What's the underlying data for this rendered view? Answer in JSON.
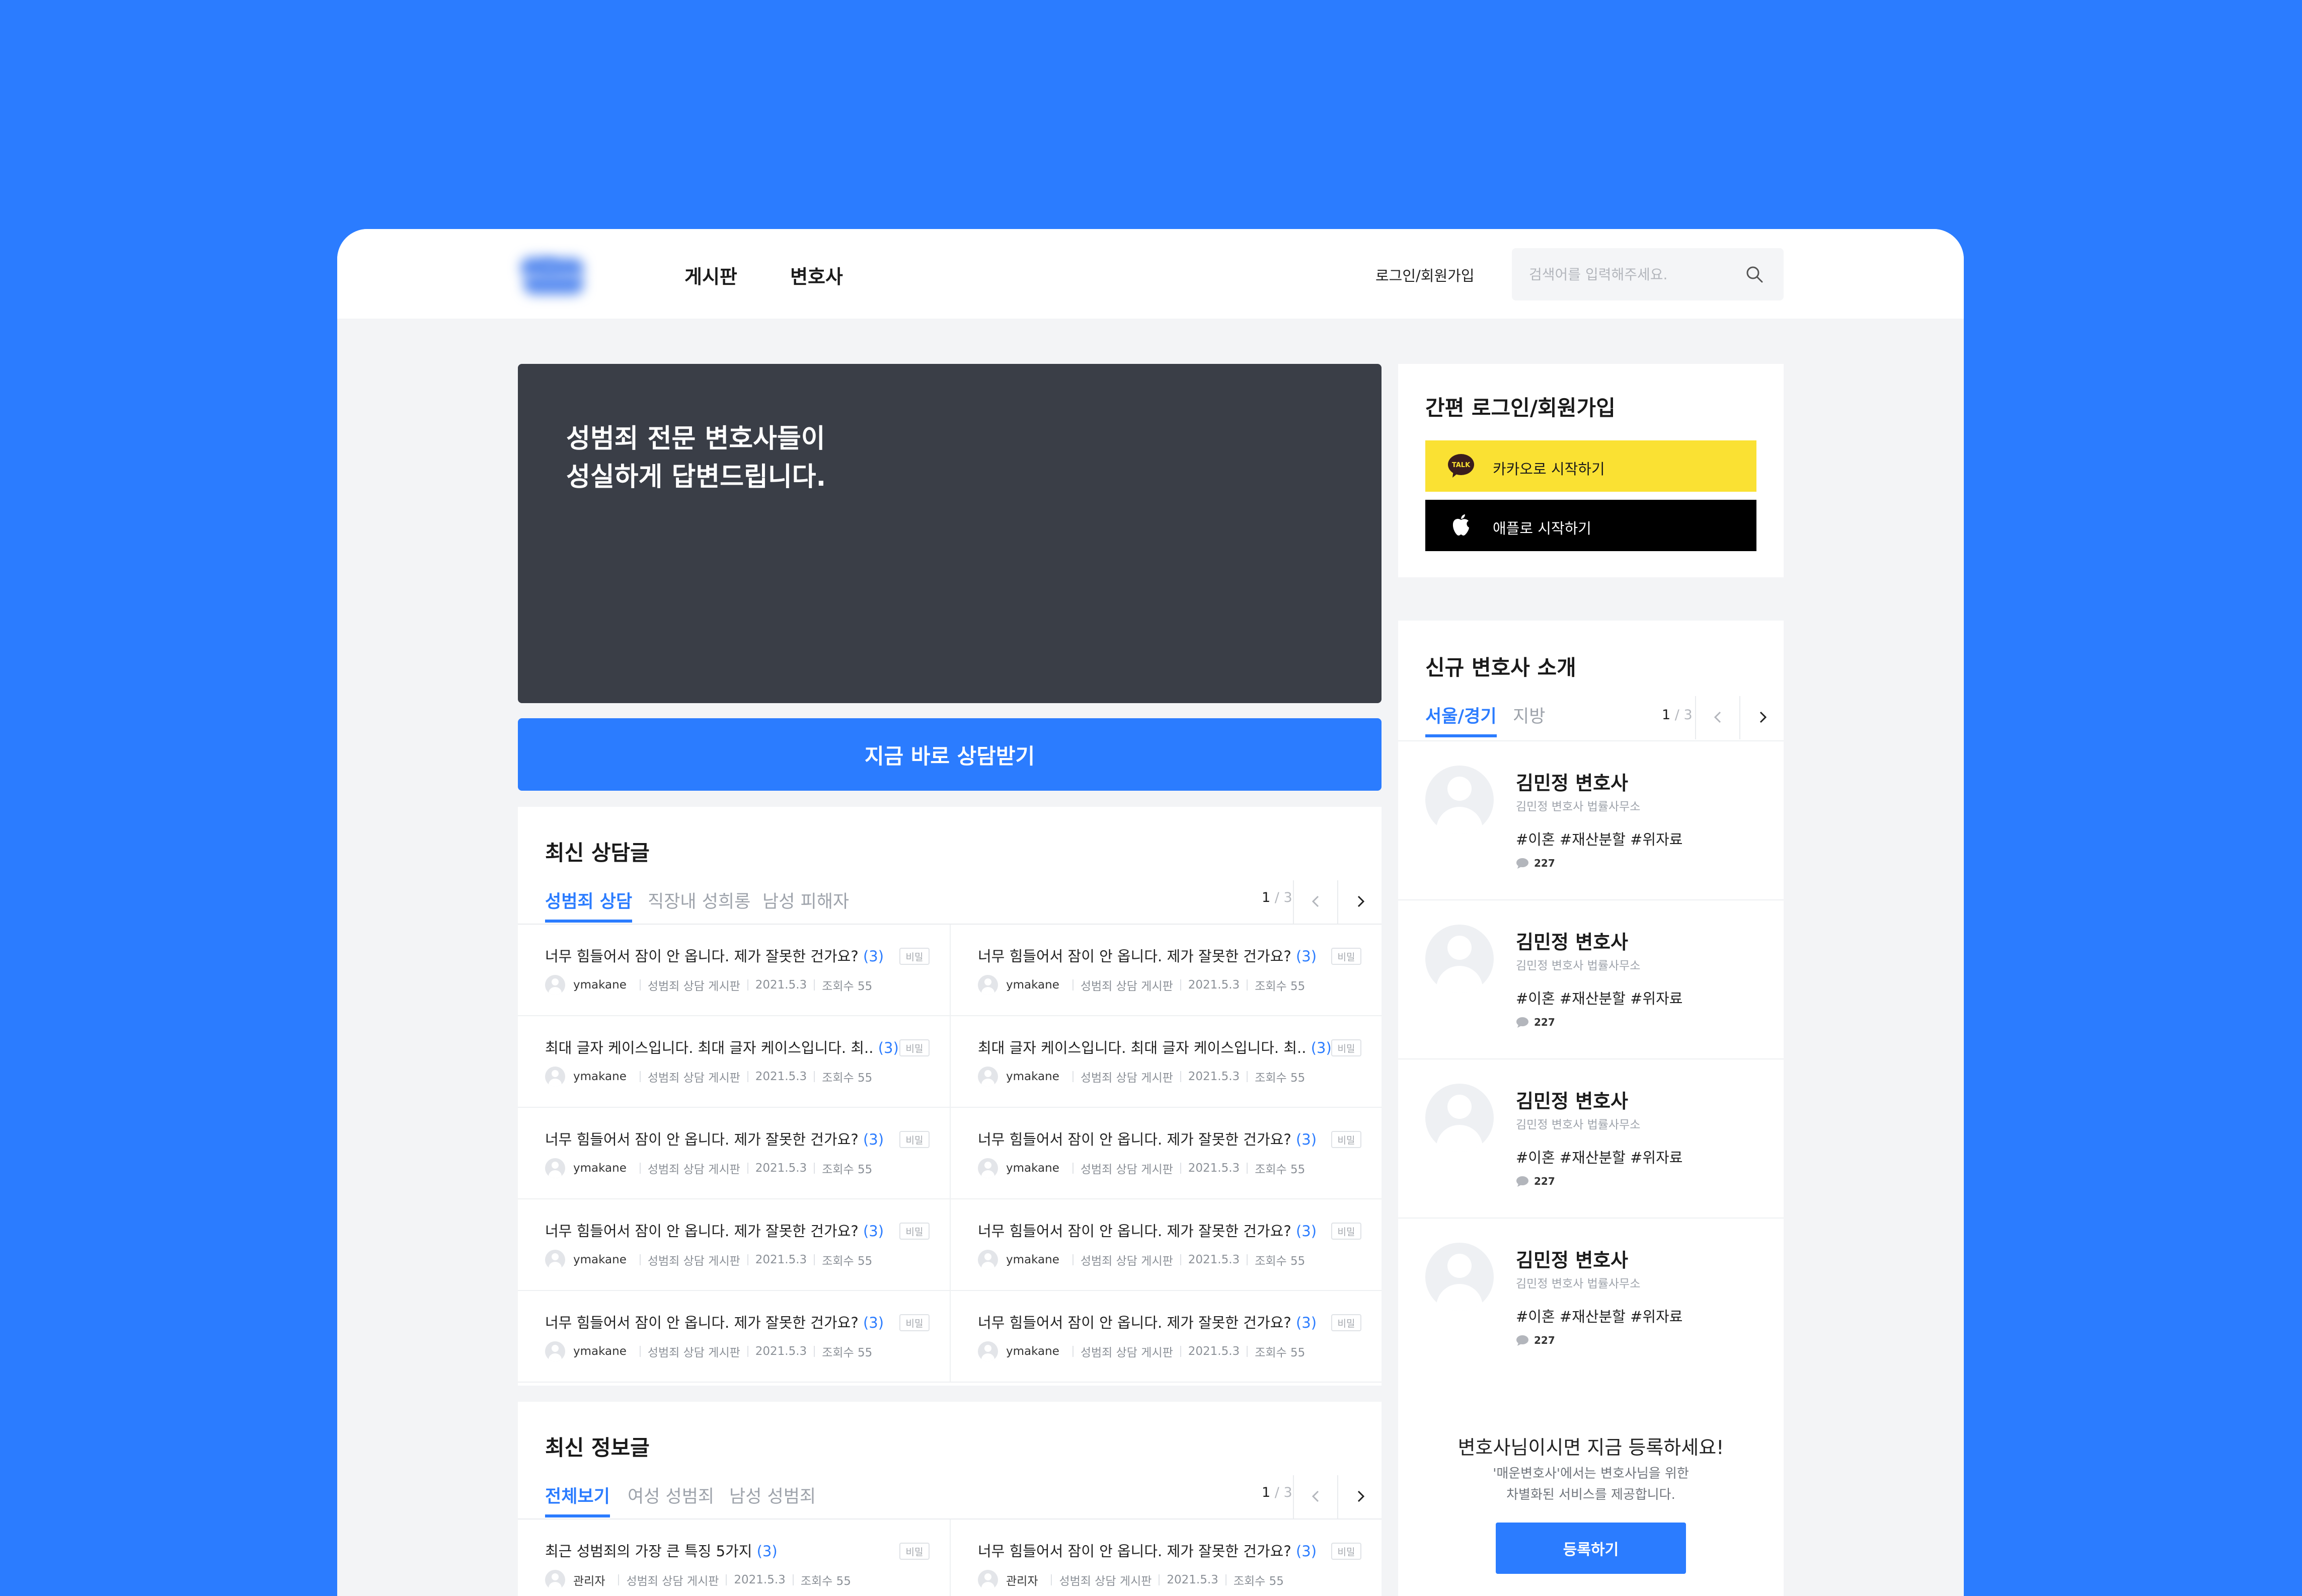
{
  "header": {
    "nav": [
      "게시판",
      "변호사"
    ],
    "login_link": "로그인/회원가입",
    "search_placeholder": "검색어를 입력해주세요."
  },
  "banner": {
    "line1": "성범죄 전문 변호사들이",
    "line2": "성실하게 답변드립니다."
  },
  "cta_label": "지금 바로 상담받기",
  "latest_consult": {
    "title": "최신 상담글",
    "tabs": [
      "성범죄 상담",
      "직장내 성희롱",
      "남성 피해자"
    ],
    "active_tab": 0,
    "page_current": "1",
    "page_total": " / 3",
    "posts": [
      {
        "title": "너무 힘들어서 잠이 안 옵니다. 제가 잘못한 건가요?",
        "count": "(3)",
        "tag": "비밀",
        "user": "ymakane",
        "board": "성범죄 상담 게시판",
        "date": "2021.5.3",
        "views": "조회수 55"
      },
      {
        "title": "너무 힘들어서 잠이 안 옵니다. 제가 잘못한 건가요?",
        "count": "(3)",
        "tag": "비밀",
        "user": "ymakane",
        "board": "성범죄 상담 게시판",
        "date": "2021.5.3",
        "views": "조회수 55"
      },
      {
        "title": "최대 글자 케이스입니다. 최대 글자 케이스입니다. 최..",
        "count": "(3)",
        "tag": "비밀",
        "user": "ymakane",
        "board": "성범죄 상담 게시판",
        "date": "2021.5.3",
        "views": "조회수 55"
      },
      {
        "title": "최대 글자 케이스입니다. 최대 글자 케이스입니다. 최..",
        "count": "(3)",
        "tag": "비밀",
        "user": "ymakane",
        "board": "성범죄 상담 게시판",
        "date": "2021.5.3",
        "views": "조회수 55"
      },
      {
        "title": "너무 힘들어서 잠이 안 옵니다. 제가 잘못한 건가요?",
        "count": "(3)",
        "tag": "비밀",
        "user": "ymakane",
        "board": "성범죄 상담 게시판",
        "date": "2021.5.3",
        "views": "조회수 55"
      },
      {
        "title": "너무 힘들어서 잠이 안 옵니다. 제가 잘못한 건가요?",
        "count": "(3)",
        "tag": "비밀",
        "user": "ymakane",
        "board": "성범죄 상담 게시판",
        "date": "2021.5.3",
        "views": "조회수 55"
      },
      {
        "title": "너무 힘들어서 잠이 안 옵니다. 제가 잘못한 건가요?",
        "count": "(3)",
        "tag": "비밀",
        "user": "ymakane",
        "board": "성범죄 상담 게시판",
        "date": "2021.5.3",
        "views": "조회수 55"
      },
      {
        "title": "너무 힘들어서 잠이 안 옵니다. 제가 잘못한 건가요?",
        "count": "(3)",
        "tag": "비밀",
        "user": "ymakane",
        "board": "성범죄 상담 게시판",
        "date": "2021.5.3",
        "views": "조회수 55"
      },
      {
        "title": "너무 힘들어서 잠이 안 옵니다. 제가 잘못한 건가요?",
        "count": "(3)",
        "tag": "비밀",
        "user": "ymakane",
        "board": "성범죄 상담 게시판",
        "date": "2021.5.3",
        "views": "조회수 55"
      },
      {
        "title": "너무 힘들어서 잠이 안 옵니다. 제가 잘못한 건가요?",
        "count": "(3)",
        "tag": "비밀",
        "user": "ymakane",
        "board": "성범죄 상담 게시판",
        "date": "2021.5.3",
        "views": "조회수 55"
      }
    ]
  },
  "latest_info": {
    "title": "최신 정보글",
    "tabs": [
      "전체보기",
      "여성 성범죄",
      "남성 성범죄"
    ],
    "active_tab": 0,
    "page_current": "1",
    "page_total": " / 3",
    "posts": [
      {
        "title": "최근 성범죄의 가장 큰 특징 5가지",
        "count": "(3)",
        "tag": "비밀",
        "user": "관리자",
        "board": "성범죄 상담 게시판",
        "date": "2021.5.3",
        "views": "조회수 55"
      },
      {
        "title": "너무 힘들어서 잠이 안 옵니다. 제가 잘못한 건가요?",
        "count": "(3)",
        "tag": "비밀",
        "user": "관리자",
        "board": "성범죄 상담 게시판",
        "date": "2021.5.3",
        "views": "조회수 55"
      }
    ]
  },
  "login_card": {
    "title": "간편 로그인/회원가입",
    "kakao_badge": "TALK",
    "kakao_label": "카카오로 시작하기",
    "apple_label": "애플로 시작하기"
  },
  "lawyers": {
    "title": "신규 변호사 소개",
    "tabs": [
      "서울/경기",
      "지방"
    ],
    "active_tab": 0,
    "page_current": "1",
    "page_total": " / 3",
    "items": [
      {
        "name": "김민정 변호사",
        "office": "김민정 변호사 법률사무소",
        "tags": "#이혼 #재산분할 #위자료",
        "comments": "227"
      },
      {
        "name": "김민정 변호사",
        "office": "김민정 변호사 법률사무소",
        "tags": "#이혼 #재산분할 #위자료",
        "comments": "227"
      },
      {
        "name": "김민정 변호사",
        "office": "김민정 변호사 법률사무소",
        "tags": "#이혼 #재산분할 #위자료",
        "comments": "227"
      },
      {
        "name": "김민정 변호사",
        "office": "김민정 변호사 법률사무소",
        "tags": "#이혼 #재산분할 #위자료",
        "comments": "227"
      }
    ]
  },
  "register": {
    "heading": "변호사님이시면 지금 등록하세요!",
    "sub1": "'매운변호사'에서는 변호사님을 위한",
    "sub2": "차별화된 서비스를 제공합니다.",
    "button": "등록하기"
  },
  "colors": {
    "accent": "#2b7cff",
    "banner": "#3a3e47",
    "kakao": "#fae133",
    "apple": "#000000"
  },
  "icons": [
    "search-icon",
    "kakao-talk-icon",
    "apple-icon",
    "chevron-left-icon",
    "chevron-right-icon",
    "comment-icon",
    "avatar-icon"
  ]
}
